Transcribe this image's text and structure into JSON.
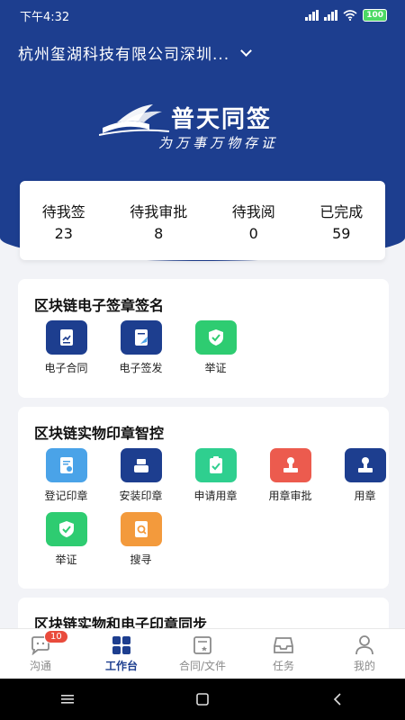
{
  "status": {
    "time": "下午4:32",
    "battery": "100"
  },
  "header": {
    "company": "杭州玺湖科技有限公司深圳..."
  },
  "logo": {
    "title": "普天同签",
    "slogan": "为万事万物存证"
  },
  "stats": [
    {
      "label": "待我签",
      "value": "23"
    },
    {
      "label": "待我审批",
      "value": "8"
    },
    {
      "label": "待我阅",
      "value": "0"
    },
    {
      "label": "已完成",
      "value": "59"
    }
  ],
  "sections": [
    {
      "title": "区块链电子签章签名",
      "items": [
        {
          "label": "电子合同",
          "icon": "contract-icon",
          "color": "#1d3e8f"
        },
        {
          "label": "电子签发",
          "icon": "sign-send-icon",
          "color": "#1d3e8f"
        },
        {
          "label": "举证",
          "icon": "shield-check-icon",
          "color": "#2ecc71"
        }
      ]
    },
    {
      "title": "区块链实物印章智控",
      "items": [
        {
          "label": "登记印章",
          "icon": "register-seal-icon",
          "color": "#4aa3e8"
        },
        {
          "label": "安装印章",
          "icon": "install-seal-icon",
          "color": "#1d3e8f"
        },
        {
          "label": "申请用章",
          "icon": "apply-seal-icon",
          "color": "#2fcf8f"
        },
        {
          "label": "用章审批",
          "icon": "seal-approve-icon",
          "color": "#ec5b4e"
        },
        {
          "label": "用章",
          "icon": "use-seal-icon",
          "color": "#1d3e8f"
        },
        {
          "label": "举证",
          "icon": "shield-check-icon",
          "color": "#2ecc71"
        },
        {
          "label": "搜寻",
          "icon": "search-doc-icon",
          "color": "#f39a3c"
        }
      ]
    },
    {
      "title": "区块链实物和电子印章同步"
    }
  ],
  "tabs": [
    {
      "label": "沟通",
      "badge": "10"
    },
    {
      "label": "工作台"
    },
    {
      "label": "合同/文件"
    },
    {
      "label": "任务"
    },
    {
      "label": "我的"
    }
  ],
  "colors": {
    "brand": "#1d3e8f",
    "badge": "#e94b3c"
  }
}
